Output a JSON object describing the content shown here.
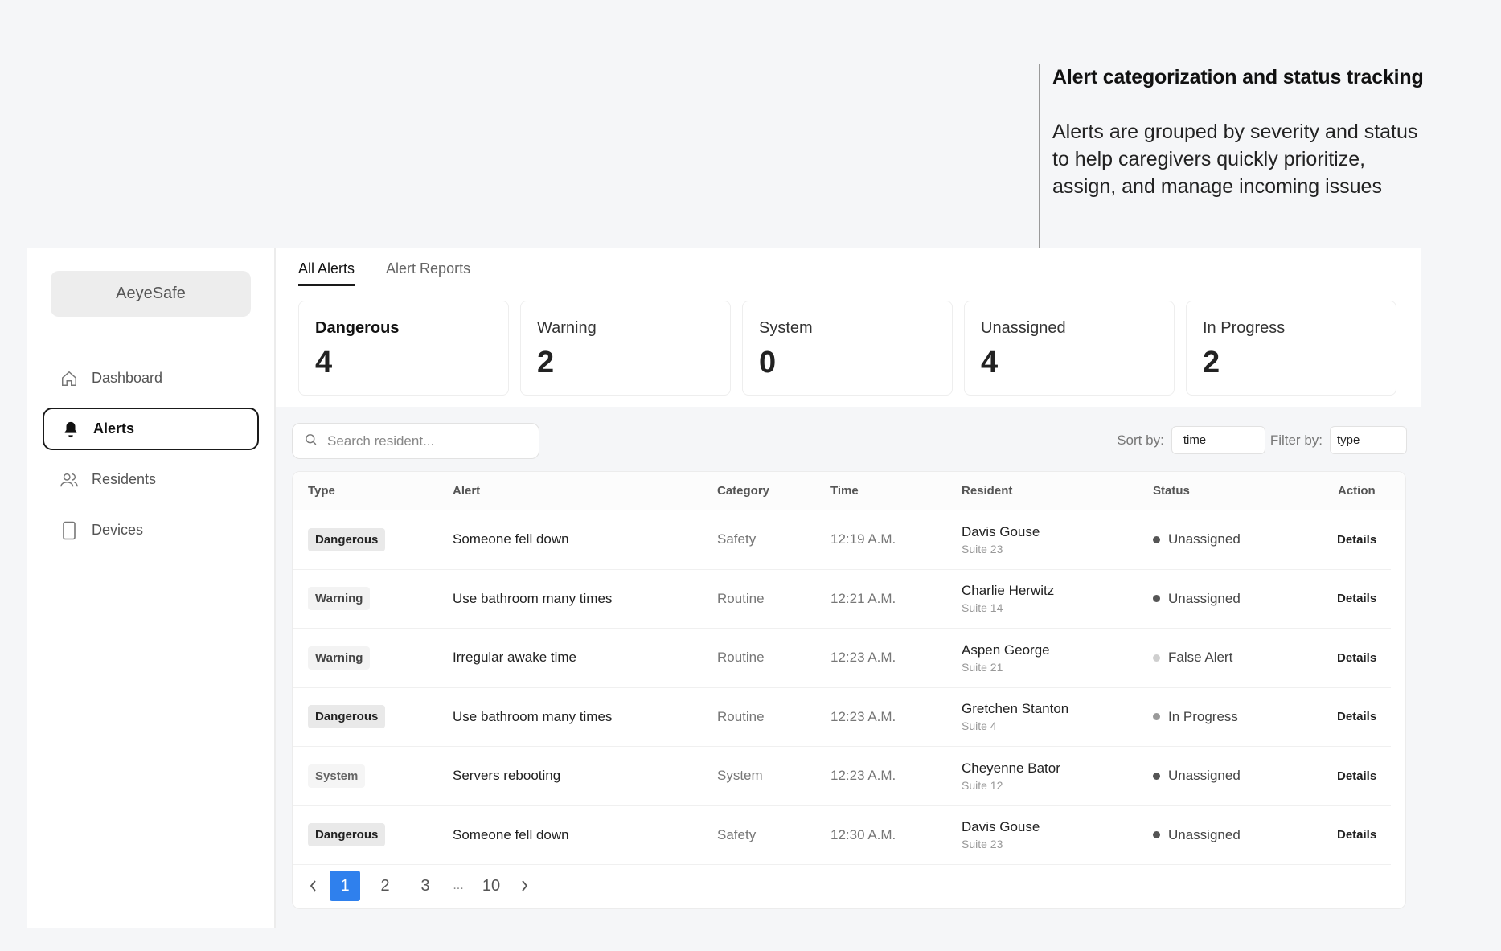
{
  "annotation": {
    "title": "Alert categorization and status tracking",
    "body": "Alerts are grouped by severity and status to help caregivers quickly prioritize, assign, and manage incoming issues"
  },
  "app": {
    "logo": "AeyeSafe"
  },
  "sidebar": {
    "items": [
      {
        "label": "Dashboard",
        "icon": "home-icon"
      },
      {
        "label": "Alerts",
        "icon": "bell-icon",
        "active": true
      },
      {
        "label": "Residents",
        "icon": "users-icon"
      },
      {
        "label": "Devices",
        "icon": "device-icon"
      }
    ]
  },
  "tabs": [
    {
      "label": "All Alerts",
      "active": true
    },
    {
      "label": "Alert Reports"
    }
  ],
  "summary": [
    {
      "label": "Dangerous",
      "value": "4"
    },
    {
      "label": "Warning",
      "value": "2"
    },
    {
      "label": "System",
      "value": "0"
    },
    {
      "label": "Unassigned",
      "value": "4"
    },
    {
      "label": "In Progress",
      "value": "2"
    }
  ],
  "search": {
    "placeholder": "Search resident..."
  },
  "controls": {
    "sort_label": "Sort by:",
    "sort_value": "time",
    "filter_label": "Filter by:",
    "filter_value": "type"
  },
  "table": {
    "headers": {
      "type": "Type",
      "alert": "Alert",
      "category": "Category",
      "time": "Time",
      "resident": "Resident",
      "status": "Status",
      "action": "Action"
    },
    "rows": [
      {
        "type": "Dangerous",
        "alert": "Someone fell down",
        "category": "Safety",
        "time": "12:19 A.M.",
        "resident": "Davis Gouse",
        "suite": "Suite 23",
        "status": "Unassigned",
        "action": "Details"
      },
      {
        "type": "Warning",
        "alert": "Use bathroom many times",
        "category": "Routine",
        "time": "12:21 A.M.",
        "resident": "Charlie Herwitz",
        "suite": "Suite 14",
        "status": "Unassigned",
        "action": "Details"
      },
      {
        "type": "Warning",
        "alert": "Irregular awake time",
        "category": "Routine",
        "time": "12:23 A.M.",
        "resident": "Aspen George",
        "suite": "Suite 21",
        "status": "False Alert",
        "action": "Details"
      },
      {
        "type": "Dangerous",
        "alert": "Use bathroom many times",
        "category": "Routine",
        "time": "12:23 A.M.",
        "resident": "Gretchen Stanton",
        "suite": "Suite 4",
        "status": "In Progress",
        "action": "Details"
      },
      {
        "type": "System",
        "alert": "Servers rebooting",
        "category": "System",
        "time": "12:23 A.M.",
        "resident": "Cheyenne Bator",
        "suite": "Suite 12",
        "status": "Unassigned",
        "action": "Details"
      },
      {
        "type": "Dangerous",
        "alert": "Someone fell down",
        "category": "Safety",
        "time": "12:30 A.M.",
        "resident": "Davis Gouse",
        "suite": "Suite 23",
        "status": "Unassigned",
        "action": "Details"
      }
    ]
  },
  "pagination": {
    "pages": [
      "1",
      "2",
      "3",
      "...",
      "10"
    ],
    "current": "1"
  }
}
